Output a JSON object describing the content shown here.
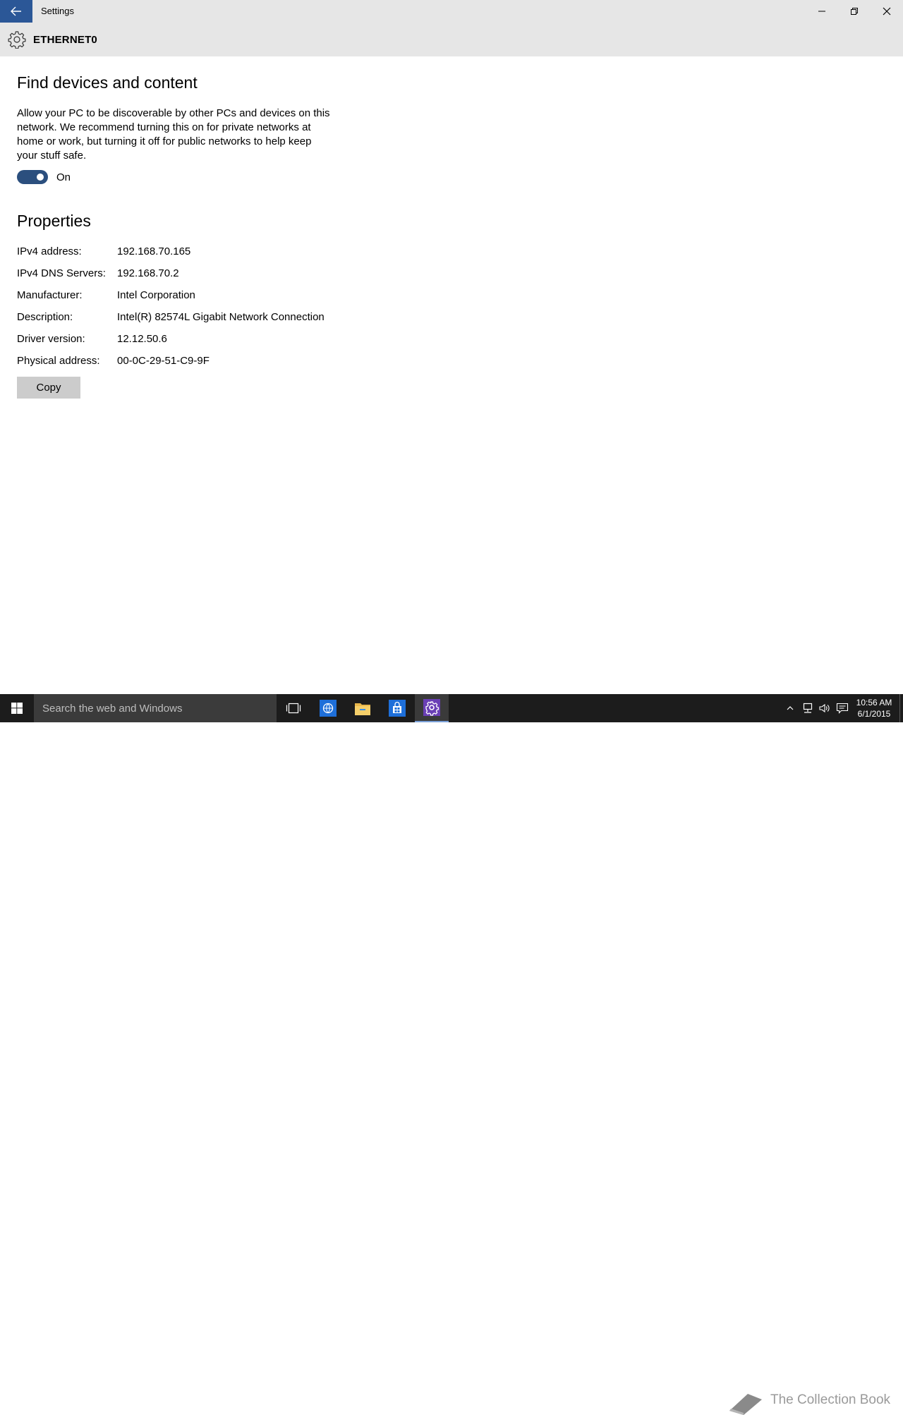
{
  "window": {
    "title": "Settings"
  },
  "header": {
    "title": "ETHERNET0"
  },
  "find_devices": {
    "title": "Find devices and content",
    "description": "Allow your PC to be discoverable by other PCs and devices on this network. We recommend turning this on for private networks at home or work, but turning it off for public networks to help keep your stuff safe.",
    "toggle_state": "On",
    "toggle_on": true,
    "toggle_color": "#2b4f7e"
  },
  "properties": {
    "title": "Properties",
    "rows": [
      {
        "label": "IPv4 address:",
        "value": "192.168.70.165"
      },
      {
        "label": "IPv4 DNS Servers:",
        "value": "192.168.70.2"
      },
      {
        "label": "Manufacturer:",
        "value": "Intel Corporation"
      },
      {
        "label": "Description:",
        "value": "Intel(R) 82574L Gigabit Network Connection"
      },
      {
        "label": "Driver version:",
        "value": "12.12.50.6"
      },
      {
        "label": "Physical address:",
        "value": "00-0C-29-51-C9-9F"
      }
    ],
    "copy_label": "Copy"
  },
  "taskbar": {
    "search_placeholder": "Search the web and Windows",
    "apps": [
      "task-view-icon",
      "edge-icon",
      "file-explorer-icon",
      "store-icon",
      "settings-icon"
    ],
    "active_app": "settings-icon",
    "watermark": "The Collection Book",
    "clock_time": "10:56 AM",
    "clock_date": "6/1/2015"
  },
  "colors": {
    "accent": "#2b5797",
    "chrome": "#e6e6e6",
    "taskbar": "#1c1c1c"
  }
}
